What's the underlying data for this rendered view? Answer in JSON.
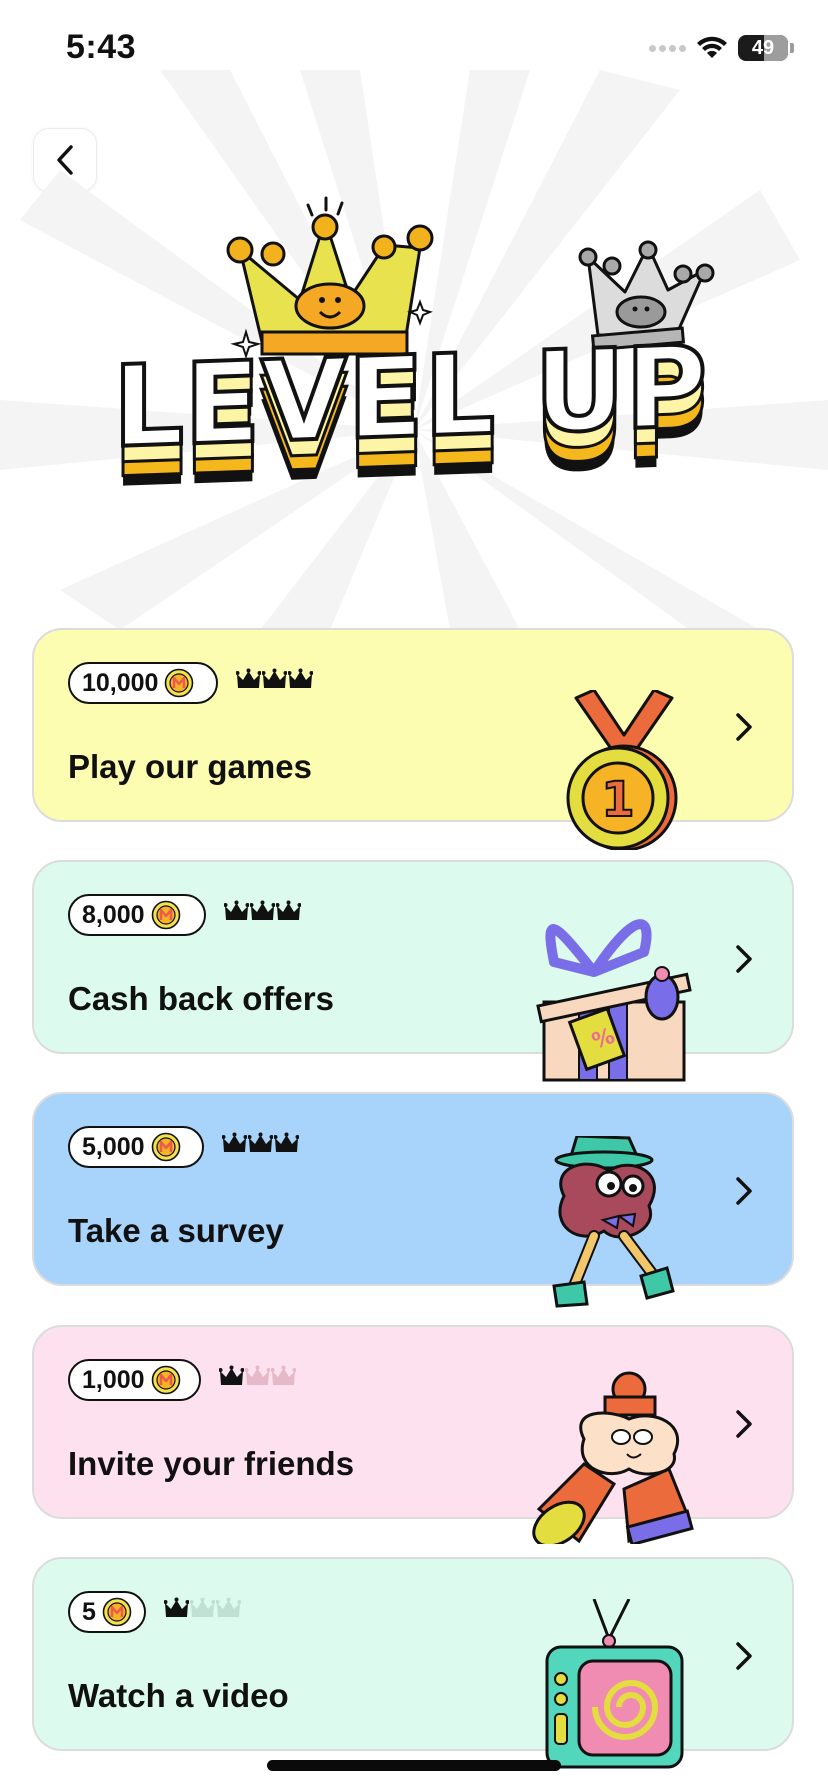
{
  "status_bar": {
    "time": "5:43",
    "battery": "49"
  },
  "header": {
    "title": "LEVEL UP"
  },
  "colors": {
    "card_yellow": "#fcfdb0",
    "card_mint": "#dcfbee",
    "card_blue": "#a8d4fb",
    "card_pink": "#fde1ef",
    "coin": "#f4e14f",
    "coin_m": "#ec5b4b"
  },
  "offers": [
    {
      "amount": "10,000",
      "crowns_filled": 3,
      "title": "Play our games",
      "illustration": "medal-icon"
    },
    {
      "amount": "8,000",
      "crowns_filled": 3,
      "title": "Cash back offers",
      "illustration": "gift-box-icon"
    },
    {
      "amount": "5,000",
      "crowns_filled": 3,
      "title": "Take a survey",
      "illustration": "survey-character-icon"
    },
    {
      "amount": "1,000",
      "crowns_filled": 1,
      "title": "Invite your friends",
      "illustration": "friends-character-icon"
    },
    {
      "amount": "5",
      "crowns_filled": 1,
      "title": "Watch a video",
      "illustration": "tv-icon"
    }
  ]
}
